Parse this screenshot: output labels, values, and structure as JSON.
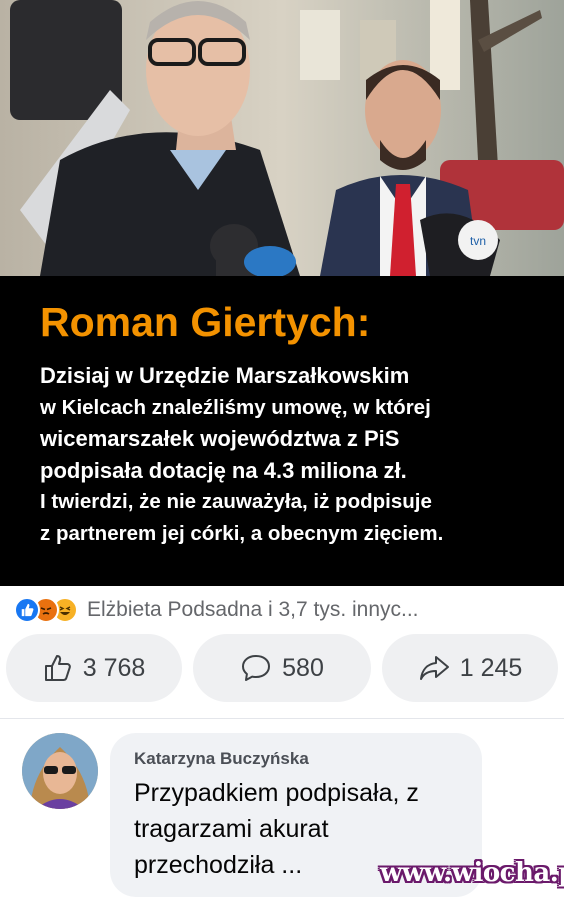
{
  "post": {
    "photo_description_icon": "news-photo",
    "quote": {
      "title": "Roman Giertych:",
      "lines": [
        "Dzisiaj w Urzędzie Marszałkowskim",
        "w Kielcach znaleźliśmy umowę, w której",
        "wicemarszałek województwa z PiS",
        "podpisała dotację na 4.3 miliona zł.",
        "I twierdzi, że nie zauważyła, iż podpisuje",
        "z partnerem jej córki, a obecnym zięciem."
      ],
      "title_color": "#f39200",
      "background": "#000000"
    },
    "reactions": {
      "icons": [
        "like-icon",
        "angry-icon",
        "haha-icon"
      ],
      "summary": "Elżbieta Podsadna i 3,7 tys. innyc..."
    },
    "actions": {
      "like_count": "3 768",
      "comment_count": "580",
      "share_count": "1 245"
    }
  },
  "comment": {
    "author": "Katarzyna Buczyńska",
    "text_lines": [
      "Przypadkiem podpisała, z",
      "tragarzami akurat",
      "przechodziła ..."
    ]
  },
  "watermark": "www.wiocha.pl"
}
